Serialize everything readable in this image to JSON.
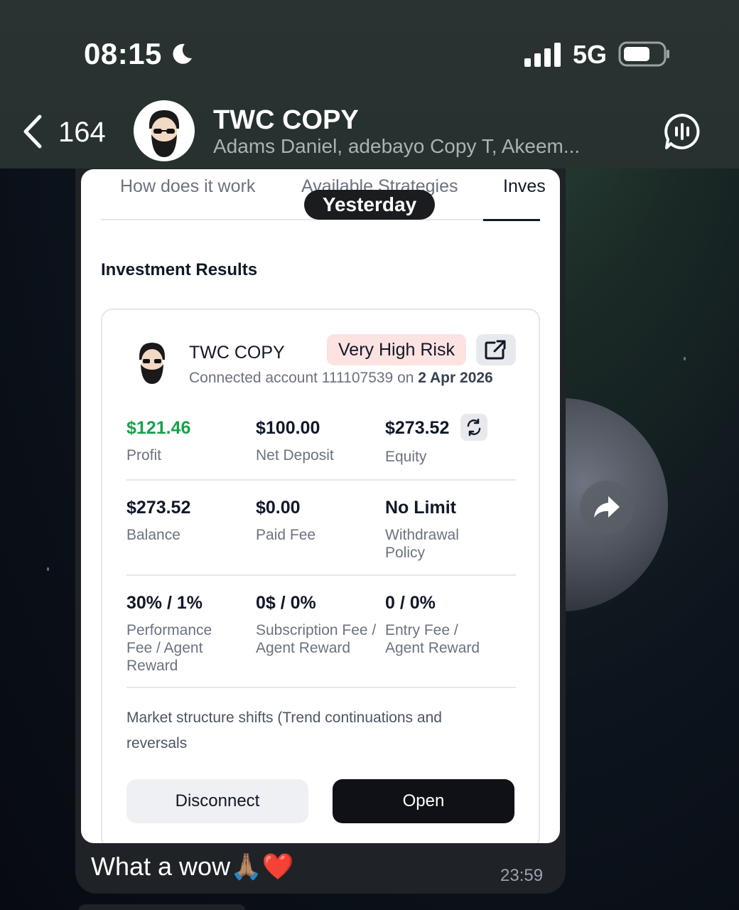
{
  "status_bar": {
    "time": "08:15",
    "network": "5G"
  },
  "header": {
    "back_count": "164",
    "title": "TWC COPY",
    "subtitle": "Adams Daniel, adebayo Copy T, Akeem..."
  },
  "date_separator": "Yesterday",
  "screenshot": {
    "tabs": [
      "How does it work",
      "Available Strategies",
      "Inves"
    ],
    "section_title": "Investment Results",
    "card": {
      "name": "TWC COPY",
      "risk_badge": "Very High Risk",
      "connected_prefix": "Connected account 111107539 on",
      "connected_date": "2 Apr 2026",
      "metrics": [
        {
          "value": "$121.46",
          "label": "Profit"
        },
        {
          "value": "$100.00",
          "label": "Net Deposit"
        },
        {
          "value": "$273.52",
          "label": "Equity"
        },
        {
          "value": "$273.52",
          "label": "Balance"
        },
        {
          "value": "$0.00",
          "label": "Paid Fee"
        },
        {
          "value": "No Limit",
          "label": "Withdrawal Policy"
        },
        {
          "value": "30% / 1%",
          "label": "Performance Fee / Agent Reward"
        },
        {
          "value": "0$ / 0%",
          "label": "Subscription Fee / Agent Reward"
        },
        {
          "value": "0 / 0%",
          "label": "Entry Fee / Agent Reward"
        }
      ],
      "description": "Market structure shifts (Trend continuations and reversals",
      "disconnect_label": "Disconnect",
      "open_label": "Open"
    }
  },
  "message": {
    "text": "What a wow🙏🏽❤️",
    "time": "23:59"
  },
  "colors": {
    "profit_green": "#16a34a",
    "risk_badge_bg": "#fde2e2",
    "open_button_bg": "#0f1117"
  },
  "icons": [
    "moon-icon",
    "signal-icon",
    "battery-icon",
    "back-chevron-icon",
    "call-icon",
    "external-link-icon",
    "refresh-icon",
    "forward-icon"
  ]
}
